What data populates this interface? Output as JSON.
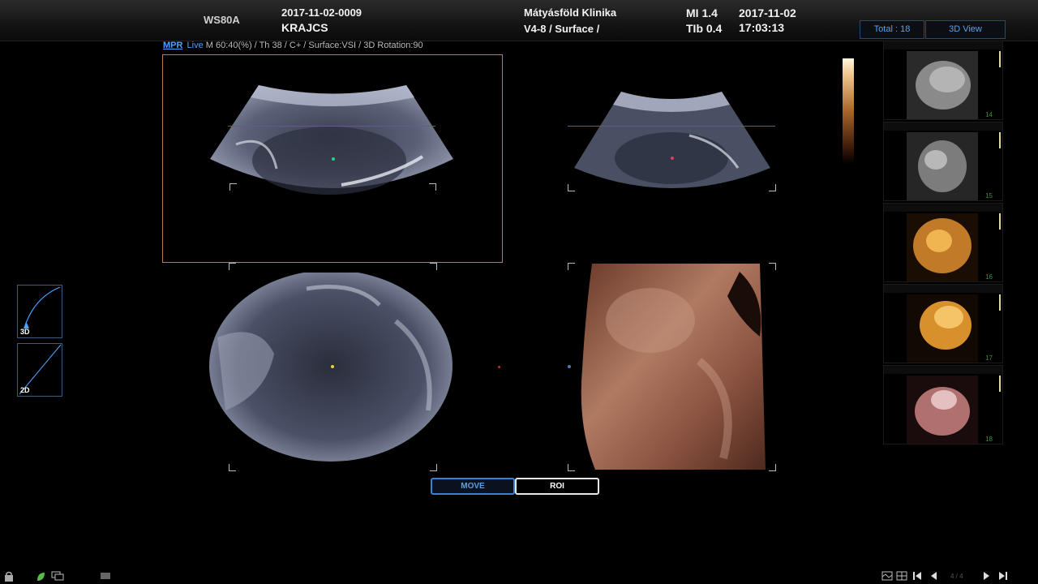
{
  "header": {
    "model": "WS80A",
    "patient_id": "2017-11-02-0009",
    "patient_name": "KRAJCS",
    "clinic": "Mátyásföld Klinika",
    "probe": "V4-8 / Surface /",
    "mi": "MI  1.4",
    "tib": "TIb 0.4",
    "date": "2017-11-02",
    "time": "17:03:13",
    "total_btn": "Total : 18",
    "view_btn": "3D View"
  },
  "status": {
    "mpr": "MPR",
    "live": "Live",
    "params": "M 60:40(%) / Th 38 / C+ / Surface:VSI / 3D Rotation:90"
  },
  "curves": {
    "curve_3d": "3D",
    "curve_2d": "2D"
  },
  "buttons": {
    "move": "MOVE",
    "roi": "ROI"
  },
  "thumbnails": [
    {
      "num": "14",
      "style": "grey"
    },
    {
      "num": "15",
      "style": "grey"
    },
    {
      "num": "16",
      "style": "gold"
    },
    {
      "num": "17",
      "style": "gold"
    },
    {
      "num": "18",
      "style": "pink"
    }
  ],
  "page_indicator": "4 / 4",
  "colors": {
    "accent": "#4da3ff",
    "active_frame": "#c07a45",
    "render": "#9a5f48"
  },
  "icons": {
    "lock": "lock-icon",
    "leaf": "leaf-icon",
    "monitor": "monitor-icon",
    "keyboard": "keyboard-icon",
    "layout_a": "layout-icon",
    "grid": "grid-icon",
    "first": "first-page-icon",
    "prev": "prev-page-icon",
    "next": "next-page-icon",
    "last": "last-page-icon"
  }
}
